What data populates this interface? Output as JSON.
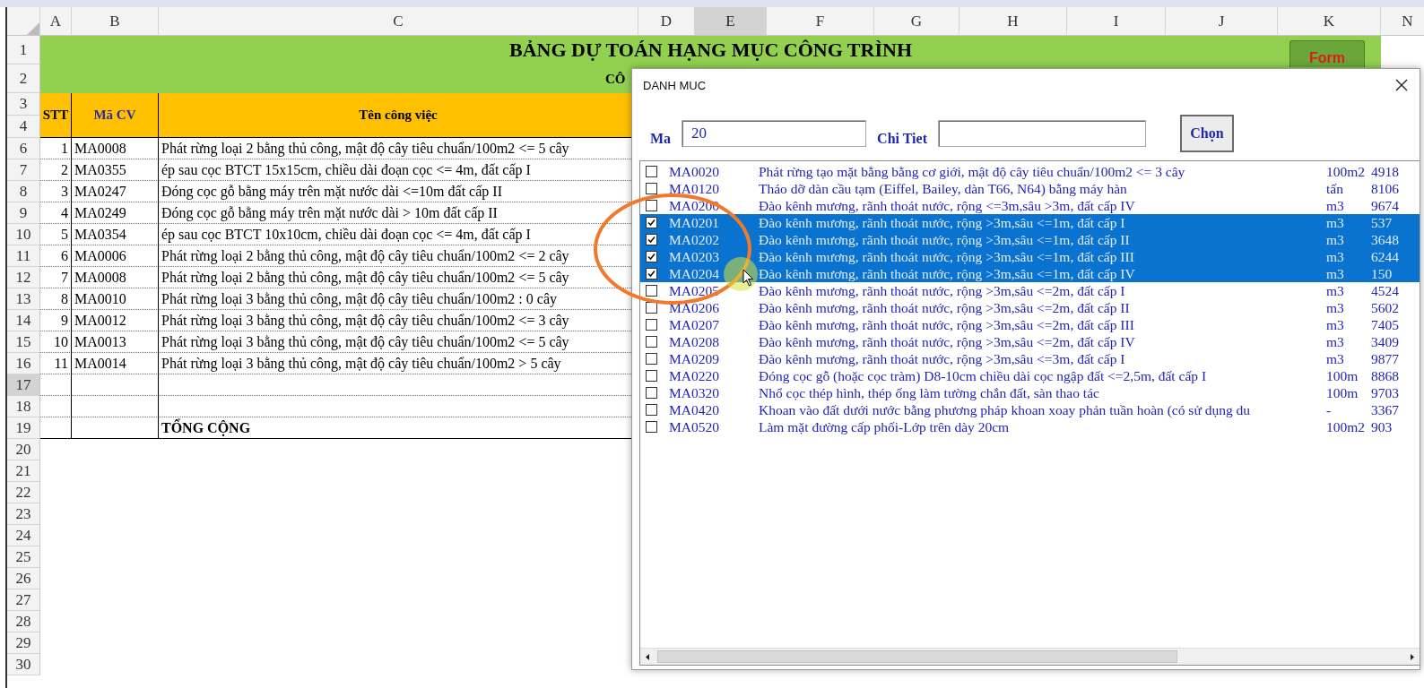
{
  "columns": [
    {
      "label": "A",
      "selected": false
    },
    {
      "label": "B",
      "selected": false
    },
    {
      "label": "C",
      "selected": false
    },
    {
      "label": "D",
      "selected": false
    },
    {
      "label": "E",
      "selected": true
    },
    {
      "label": "F",
      "selected": false
    },
    {
      "label": "G",
      "selected": false
    },
    {
      "label": "H",
      "selected": false
    },
    {
      "label": "I",
      "selected": false
    },
    {
      "label": "J",
      "selected": false
    },
    {
      "label": "K",
      "selected": false
    },
    {
      "label": "N",
      "selected": false
    }
  ],
  "row_headers": [
    {
      "label": "1",
      "selected": false
    },
    {
      "label": "2",
      "selected": false
    },
    {
      "label": "3",
      "selected": false
    },
    {
      "label": "4",
      "selected": false
    },
    {
      "label": "6",
      "selected": false
    },
    {
      "label": "7",
      "selected": false
    },
    {
      "label": "8",
      "selected": false
    },
    {
      "label": "9",
      "selected": false
    },
    {
      "label": "10",
      "selected": false
    },
    {
      "label": "11",
      "selected": false
    },
    {
      "label": "12",
      "selected": false
    },
    {
      "label": "13",
      "selected": false
    },
    {
      "label": "14",
      "selected": false
    },
    {
      "label": "15",
      "selected": false
    },
    {
      "label": "16",
      "selected": false
    },
    {
      "label": "17",
      "selected": true
    },
    {
      "label": "18",
      "selected": false
    },
    {
      "label": "19",
      "selected": false
    },
    {
      "label": "20",
      "selected": false
    },
    {
      "label": "21",
      "selected": false
    },
    {
      "label": "22",
      "selected": false
    },
    {
      "label": "23",
      "selected": false
    },
    {
      "label": "24",
      "selected": false
    },
    {
      "label": "25",
      "selected": false
    },
    {
      "label": "26",
      "selected": false
    },
    {
      "label": "27",
      "selected": false
    },
    {
      "label": "28",
      "selected": false
    },
    {
      "label": "29",
      "selected": false
    },
    {
      "label": "30",
      "selected": false
    }
  ],
  "sheet": {
    "title": "BẢNG DỰ TOÁN HẠNG MỤC CÔNG TRÌNH",
    "subtitle": "CÔ",
    "form_button": "Form",
    "headers": [
      "STT",
      "Mã CV",
      "Tên công việc"
    ],
    "rows": [
      {
        "kind": "data",
        "stt": "1",
        "code": "MA0008",
        "name": "Phát rừng loại 2 bằng thủ công, mật độ cây tiêu chuẩn/100m2 <= 5 cây"
      },
      {
        "kind": "data",
        "stt": "2",
        "code": "MA0355",
        "name": "ép sau cọc BTCT 15x15cm, chiều dài đoạn cọc <= 4m, đất cấp I"
      },
      {
        "kind": "data",
        "stt": "3",
        "code": "MA0247",
        "name": "Đóng cọc gỗ bằng máy trên mặt nước dài <=10m đất cấp II"
      },
      {
        "kind": "data",
        "stt": "4",
        "code": "MA0249",
        "name": "Đóng cọc gỗ bằng máy trên mặt nước dài > 10m đất cấp II"
      },
      {
        "kind": "data",
        "stt": "5",
        "code": "MA0354",
        "name": "ép sau cọc BTCT 10x10cm, chiều dài đoạn cọc <= 4m, đất cấp I"
      },
      {
        "kind": "data",
        "stt": "6",
        "code": "MA0006",
        "name": "Phát rừng loại 2 bằng thủ công, mật độ cây tiêu chuẩn/100m2 <= 2 cây"
      },
      {
        "kind": "data",
        "stt": "7",
        "code": "MA0008",
        "name": "Phát rừng loại 2 bằng thủ công, mật độ cây tiêu chuẩn/100m2 <= 5 cây"
      },
      {
        "kind": "data",
        "stt": "8",
        "code": "MA0010",
        "name": "Phát rừng loại 3 bằng thủ công, mật độ cây tiêu chuẩn/100m2 :  0 cây"
      },
      {
        "kind": "data",
        "stt": "9",
        "code": "MA0012",
        "name": "Phát rừng loại 3 bằng thủ công, mật độ cây tiêu chuẩn/100m2 <= 3 cây"
      },
      {
        "kind": "data",
        "stt": "10",
        "code": "MA0013",
        "name": "Phát rừng loại 3 bằng thủ công, mật độ cây tiêu chuẩn/100m2 <= 5 cây"
      },
      {
        "kind": "data",
        "stt": "11",
        "code": "MA0014",
        "name": "Phát rừng loại 3 bằng thủ công, mật độ cây tiêu chuẩn/100m2  >  5 cây"
      },
      {
        "kind": "empty"
      },
      {
        "kind": "empty"
      },
      {
        "kind": "total",
        "name": "TỔNG CỘNG"
      }
    ]
  },
  "dialog": {
    "title": "DANH MUC",
    "fields": [
      {
        "label": "Ma",
        "value": "20"
      },
      {
        "label": "Chi Tiet"
      }
    ],
    "button": "Chọn",
    "items": [
      {
        "checked": false,
        "selected": false,
        "code": "MA0020",
        "description": "Phát rừng tạo mặt bằng bằng cơ giới, mật độ cây tiêu chuẩn/100m2 <=  3 cây",
        "unit": "100m2",
        "value": "4918"
      },
      {
        "checked": false,
        "selected": false,
        "code": "MA0120",
        "description": "Tháo dỡ dàn cầu tạm (Eiffel, Bailey, dàn T66, N64) bằng máy hàn",
        "unit": "tấn",
        "value": "8106"
      },
      {
        "checked": false,
        "selected": false,
        "code": "MA0200",
        "description": "Đào kênh mương, rãnh thoát nước, rộng <=3m,sâu >3m, đất cấp IV",
        "unit": "m3",
        "value": "9674"
      },
      {
        "checked": true,
        "selected": true,
        "code": "MA0201",
        "description": "Đào kênh mương, rãnh thoát nước, rộng >3m,sâu <=1m, đất cấp I",
        "unit": "m3",
        "value": "537"
      },
      {
        "checked": true,
        "selected": true,
        "code": "MA0202",
        "description": "Đào kênh mương, rãnh thoát nước, rộng >3m,sâu <=1m, đất cấp II",
        "unit": "m3",
        "value": "3648"
      },
      {
        "checked": true,
        "selected": true,
        "code": "MA0203",
        "description": "Đào kênh mương, rãnh thoát nước, rộng >3m,sâu <=1m, đất cấp III",
        "unit": "m3",
        "value": "6244"
      },
      {
        "checked": true,
        "selected": true,
        "code": "MA0204",
        "description": "Đào kênh mương, rãnh thoát nước, rộng >3m,sâu <=1m, đất cấp IV",
        "unit": "m3",
        "value": "150"
      },
      {
        "checked": false,
        "selected": false,
        "code": "MA0205",
        "description": "Đào kênh mương, rãnh thoát nước, rộng >3m,sâu <=2m, đất cấp I",
        "unit": "m3",
        "value": "4524"
      },
      {
        "checked": false,
        "selected": false,
        "code": "MA0206",
        "description": "Đào kênh mương, rãnh thoát nước, rộng >3m,sâu <=2m, đất cấp II",
        "unit": "m3",
        "value": "5602"
      },
      {
        "checked": false,
        "selected": false,
        "code": "MA0207",
        "description": "Đào kênh mương, rãnh thoát nước, rộng >3m,sâu <=2m, đất cấp III",
        "unit": "m3",
        "value": "7405"
      },
      {
        "checked": false,
        "selected": false,
        "code": "MA0208",
        "description": "Đào kênh mương, rãnh thoát nước, rộng >3m,sâu <=2m, đất cấp IV",
        "unit": "m3",
        "value": "3409"
      },
      {
        "checked": false,
        "selected": false,
        "code": "MA0209",
        "description": "Đào kênh mương, rãnh thoát nước, rộng >3m,sâu <=3m, đất cấp I",
        "unit": "m3",
        "value": "9877"
      },
      {
        "checked": false,
        "selected": false,
        "code": "MA0220",
        "description": "Đóng cọc gỗ (hoặc cọc tràm) D8-10cm chiều dài cọc ngập đất <=2,5m, đất cấp I",
        "unit": "100m",
        "value": "8868"
      },
      {
        "checked": false,
        "selected": false,
        "code": "MA0320",
        "description": "Nhổ cọc thép hình, thép ống làm tường chắn đất, sàn thao tác",
        "unit": "100m",
        "value": "9703"
      },
      {
        "checked": false,
        "selected": false,
        "code": "MA0420",
        "description": "Khoan vào đất dưới nước bằng phương pháp  khoan xoay phản tuần hoàn (có sử dụng du",
        "unit": "-",
        "value": "3367"
      },
      {
        "checked": false,
        "selected": false,
        "code": "MA0520",
        "description": "Làm mặt đường cấp phối-Lớp trên dày 20cm",
        "unit": "100m2",
        "value": "903"
      }
    ]
  }
}
